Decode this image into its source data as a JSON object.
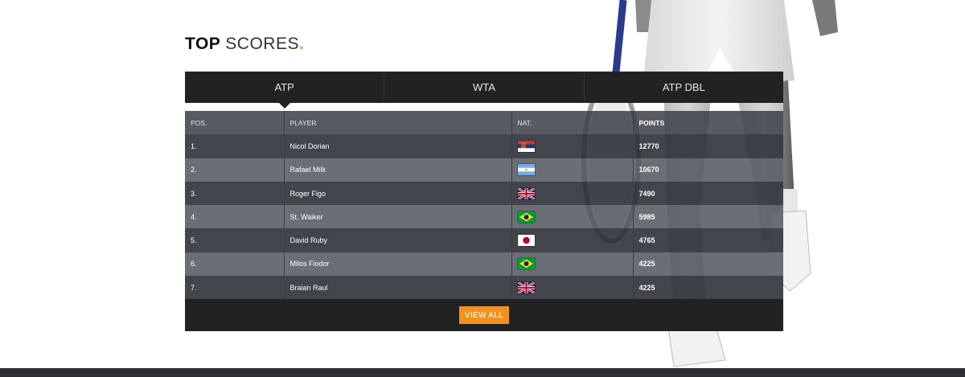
{
  "section": {
    "title_bold": "TOP",
    "title_light": "SCORES",
    "title_dot": "."
  },
  "tabs": [
    {
      "label": "ATP",
      "active": true
    },
    {
      "label": "WTA",
      "active": false
    },
    {
      "label": "ATP DBL",
      "active": false
    }
  ],
  "table": {
    "headers": {
      "pos": "POS.",
      "player": "PLAYER",
      "nat": "NAT.",
      "points": "POINTS"
    },
    "rows": [
      {
        "pos": "1.",
        "player": "Nicol Dorian",
        "flag": "serbia-flag-icon",
        "points": "12770"
      },
      {
        "pos": "2.",
        "player": "Rafael Milk",
        "flag": "argentina-flag-icon",
        "points": "10670"
      },
      {
        "pos": "3.",
        "player": "Roger Figo",
        "flag": "uk-flag-icon",
        "points": "7490"
      },
      {
        "pos": "4.",
        "player": "St. Waiker",
        "flag": "brazil-flag-icon",
        "points": "5985"
      },
      {
        "pos": "5.",
        "player": "David Ruby",
        "flag": "japan-flag-icon",
        "points": "4765"
      },
      {
        "pos": "6.",
        "player": "Milos Fiodor",
        "flag": "brazil-flag-icon",
        "points": "4225"
      },
      {
        "pos": "7.",
        "player": "Braian Raul",
        "flag": "uk-flag-icon",
        "points": "4225"
      }
    ]
  },
  "footer": {
    "view_all_label": "VIEW ALL"
  },
  "colors": {
    "accent": "#f0931e",
    "panel_dark": "#212223",
    "row_dark": "#383b41",
    "row_light": "#5f646b"
  }
}
